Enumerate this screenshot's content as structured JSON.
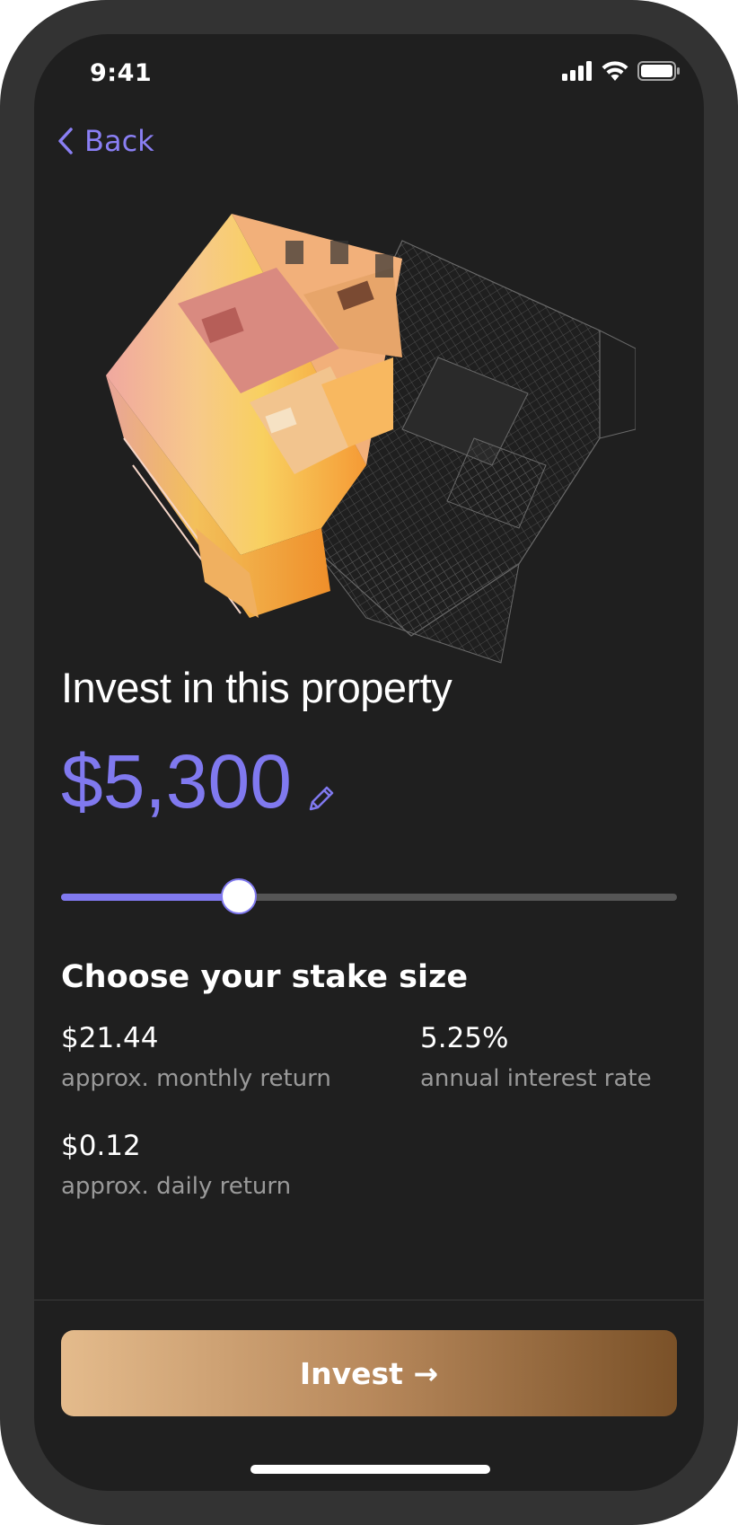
{
  "status_bar": {
    "time": "9:41",
    "icons": [
      "cellular-signal-icon",
      "wifi-icon",
      "battery-icon"
    ]
  },
  "nav": {
    "back_label": "Back",
    "back_icon": "chevron-left-icon"
  },
  "hero": {
    "image": "3d-house-floorplan-illustration"
  },
  "invest": {
    "title": "Invest in this property",
    "amount": "$5,300",
    "edit_icon": "pencil-icon",
    "slider_fraction": 0.29,
    "stake_label": "Choose your stake size"
  },
  "stats": {
    "monthly": {
      "value": "$21.44",
      "label": "approx. monthly return"
    },
    "rate": {
      "value": "5.25%",
      "label": "annual interest rate"
    },
    "daily": {
      "value": "$0.12",
      "label": "approx. daily return"
    }
  },
  "cta": {
    "label": "Invest →"
  },
  "colors": {
    "accent": "#8079ef",
    "background": "#1f1f1f",
    "button_gradient_start": "#e4bb8c",
    "button_gradient_end": "#7a5128"
  }
}
